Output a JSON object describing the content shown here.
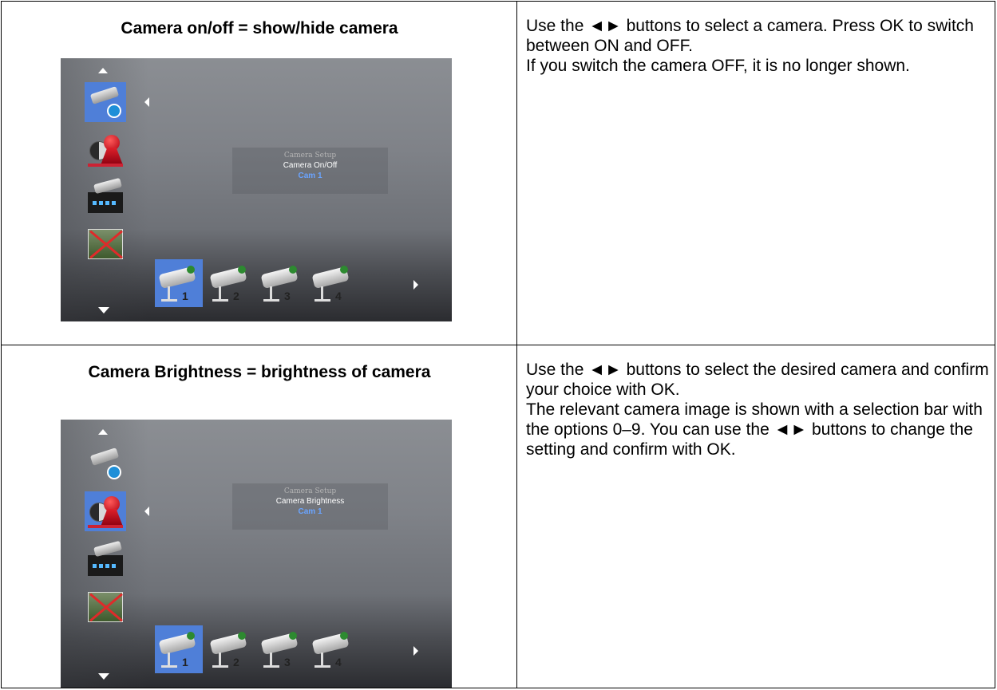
{
  "rows": [
    {
      "heading": "Camera on/off = show/hide camera",
      "description": [
        "Use the ◄► buttons to select a camera. Press OK to switch between ON and OFF.",
        "If you switch the camera OFF, it is no longer shown."
      ],
      "screen": {
        "menu_title": "Camera Setup",
        "menu_item": "Camera On/Off",
        "selected_camera": "Cam 1",
        "camera_numbers": [
          "1",
          "2",
          "3",
          "4"
        ],
        "selected_menu_icon": "camera-onoff-icon"
      }
    },
    {
      "heading": "Camera Brightness = brightness of camera",
      "description": [
        "Use the ◄► buttons to select the desired camera and confirm your choice with OK.",
        "The relevant camera image is shown with a selection bar with the options 0–9. You can use the ◄► buttons to change the setting and confirm with OK."
      ],
      "screen": {
        "menu_title": "Camera Setup",
        "menu_item": "Camera Brightness",
        "selected_camera": "Cam 1",
        "camera_numbers": [
          "1",
          "2",
          "3",
          "4"
        ],
        "selected_menu_icon": "brightness-icon"
      }
    }
  ],
  "colors": {
    "selection": "#4f7fd8",
    "highlight_text": "#6aa4ff"
  }
}
